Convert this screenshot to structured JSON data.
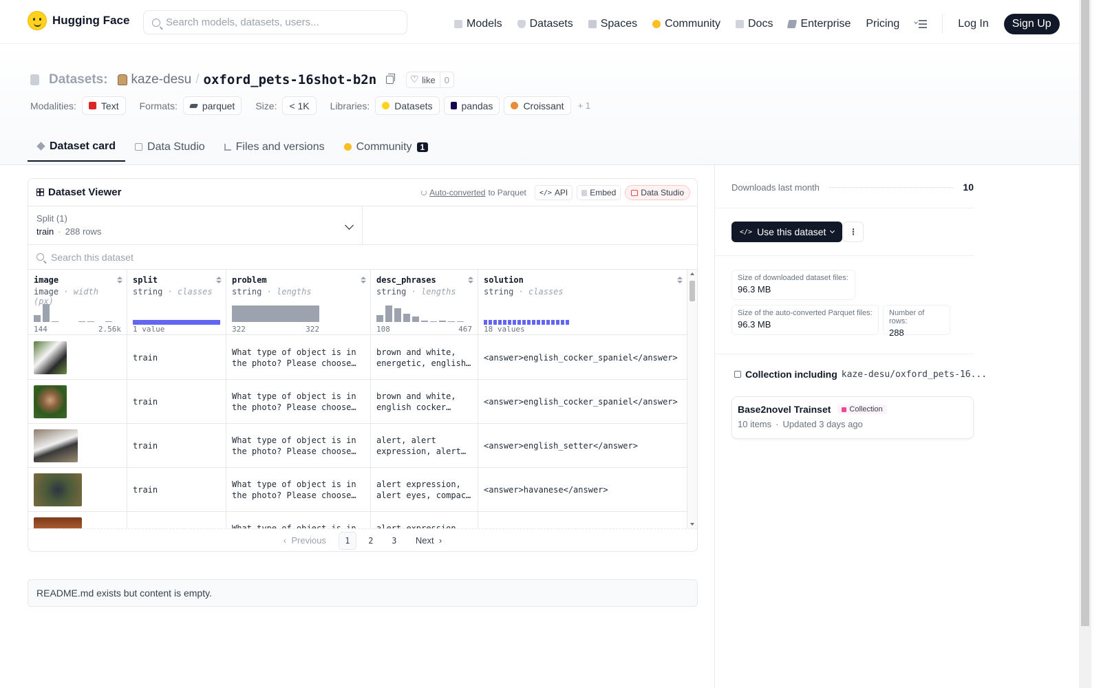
{
  "nav": {
    "brand": "Hugging Face",
    "search_placeholder": "Search models, datasets, users...",
    "links": [
      "Models",
      "Datasets",
      "Spaces",
      "Community",
      "Docs",
      "Enterprise",
      "Pricing"
    ],
    "login": "Log In",
    "signup": "Sign Up"
  },
  "repo": {
    "prefix": "Datasets:",
    "owner": "kaze-desu",
    "slash": "/",
    "name": "oxford_pets-16shot-b2n",
    "like_label": "like",
    "like_count": "0"
  },
  "tags": {
    "modalities_label": "Modalities:",
    "modality": "Text",
    "formats_label": "Formats:",
    "format": "parquet",
    "size_label": "Size:",
    "size": "< 1K",
    "libraries_label": "Libraries:",
    "libraries": [
      "Datasets",
      "pandas",
      "Croissant"
    ],
    "more": "+ 1"
  },
  "tabs": {
    "card": "Dataset card",
    "studio": "Data Studio",
    "files": "Files and versions",
    "community": "Community",
    "community_count": "1"
  },
  "viewer": {
    "title": "Dataset Viewer",
    "autoconv_link": "Auto-converted",
    "autoconv_rest": "to Parquet",
    "api": "API",
    "embed": "Embed",
    "studio": "Data Studio",
    "split_title": "Split (1)",
    "split_name": "train",
    "split_dot": "·",
    "split_rows": "288 rows",
    "search_placeholder": "Search this dataset",
    "columns": [
      {
        "name": "image",
        "type": "image",
        "sub": "width (px)",
        "min": "144",
        "max": "2.56k"
      },
      {
        "name": "split",
        "type": "string",
        "sub": "classes",
        "min": "1 value",
        "max": ""
      },
      {
        "name": "problem",
        "type": "string",
        "sub": "lengths",
        "min": "322",
        "max": "322"
      },
      {
        "name": "desc_phrases",
        "type": "string",
        "sub": "lengths",
        "min": "108",
        "max": "467"
      },
      {
        "name": "solution",
        "type": "string",
        "sub": "classes",
        "min": "18 values",
        "max": ""
      }
    ],
    "type_sep": " · ",
    "rows": [
      {
        "split": "train",
        "problem": "What type of object is in the photo? Please choose one from the list below.",
        "desc": "brown and white, energetic, english cocker spaniel",
        "solution": "<answer>english_cocker_spaniel</answer>"
      },
      {
        "split": "train",
        "problem": "What type of object is in the photo? Please choose one from the list below.",
        "desc": "brown and white, english cocker spaniel",
        "solution": "<answer>english_cocker_spaniel</answer>"
      },
      {
        "split": "train",
        "problem": "What type of object is in the photo? Please choose one from the list below.",
        "desc": "alert, alert expression, alert eyes",
        "solution": "<answer>english_setter</answer>"
      },
      {
        "split": "train",
        "problem": "What type of object is in the photo? Please choose one from the list below.",
        "desc": "alert expression, alert eyes, compact body",
        "solution": "<answer>havanese</answer>"
      },
      {
        "split": "",
        "problem": "What type of object is in the photo? Please choose one from the list below.",
        "desc": "alert expression, alert eyes",
        "solution": ""
      }
    ],
    "pager": {
      "prev": "Previous",
      "pages": [
        "1",
        "2",
        "3"
      ],
      "next": "Next"
    }
  },
  "readme": "README.md exists but content is empty.",
  "sidebar": {
    "downloads_label": "Downloads last month",
    "downloads": "10",
    "use_button": "Use this dataset",
    "kebab": "⋮",
    "stat_downloaded_label": "Size of downloaded dataset files:",
    "stat_downloaded": "96.3 MB",
    "stat_parquet_label": "Size of the auto-converted Parquet files:",
    "stat_parquet": "96.3 MB",
    "stat_rows_label": "Number of rows:",
    "stat_rows": "288",
    "collection_heading": "Collection including",
    "collection_repo": "kaze-desu/oxford_pets-16...",
    "collection_name": "Base2novel Trainset",
    "collection_badge": "Collection",
    "collection_items": "10 items",
    "collection_dot": "·",
    "collection_updated": "Updated 3 days ago"
  },
  "colors": {
    "brand": "#ffd21e",
    "accent_bar": "#6366f1",
    "dark": "#111827"
  }
}
